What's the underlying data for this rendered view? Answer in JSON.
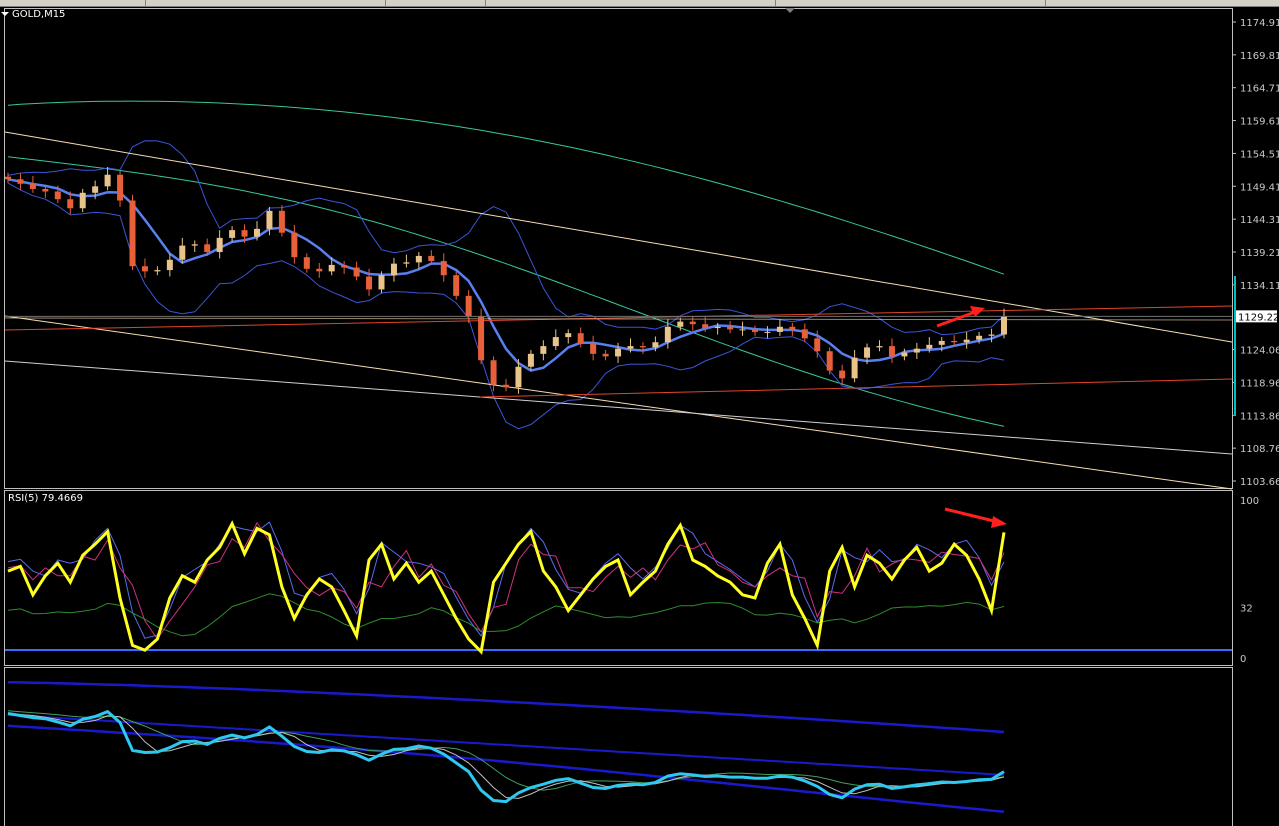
{
  "window": {
    "symbol_label": "GOLD,M15"
  },
  "colors": {
    "background": "#000000",
    "bull_candle": "#e8c48a",
    "bear_candle": "#e8603a",
    "ma_fast": "#5a7ff0",
    "bb_band": "#3a55d8",
    "envelope": "#37c7a0",
    "trend_light": "#f5deb3",
    "trend_red": "#e0452a",
    "rsi_main": "#ffff20",
    "rsi_level": "#3a6cff",
    "osc_main": "#2ec8f0",
    "osc_band": "#1a1acc",
    "arrow": "#ff2020",
    "current_price_box": "#ffffff"
  },
  "price_axis": {
    "ticks": [
      "1174.91",
      "1169.81",
      "1164.71",
      "1159.61",
      "1154.51",
      "1149.41",
      "1144.31",
      "1139.21",
      "1134.11",
      "1129.22",
      "1124.06",
      "1118.96",
      "1113.86",
      "1108.76",
      "1103.66"
    ],
    "current_price": "1129.22"
  },
  "rsi_pane": {
    "title": "RSI(5) 79.4669",
    "levels": [
      "100",
      "32",
      "0"
    ]
  },
  "chart_data": [
    {
      "type": "line",
      "title": "GOLD,M15",
      "ylim": [
        1103.66,
        1174.91
      ],
      "series": [
        {
          "values": [
            1150.5,
            1149.8,
            1149.0,
            1148.6,
            1147.4,
            1146.0,
            1148.4,
            1149.4,
            1151.2,
            1147.2,
            1137.0,
            1136.2,
            1136.4,
            1138.0,
            1140.2,
            1140.4,
            1139.2,
            1141.4,
            1142.6,
            1141.6,
            1142.8,
            1145.6,
            1142.2,
            1138.4,
            1136.6,
            1136.2,
            1137.2,
            1136.8,
            1135.4,
            1133.4,
            1135.6,
            1137.4,
            1137.6,
            1138.6,
            1137.8,
            1135.6,
            1132.4,
            1129.2,
            1122.4,
            1118.6,
            1118.2,
            1121.4,
            1123.4,
            1124.6,
            1126.0,
            1126.6,
            1125.0,
            1123.4,
            1123.0,
            1124.2,
            1124.6,
            1124.4,
            1125.2,
            1127.6,
            1128.4,
            1128.0,
            1127.4,
            1127.6,
            1127.2,
            1127.2,
            1126.8,
            1126.8,
            1127.6,
            1127.2,
            1125.8,
            1123.8,
            1120.8,
            1119.6,
            1122.8,
            1124.4,
            1124.6,
            1123.0,
            1123.6,
            1124.2,
            1124.8,
            1125.4,
            1125.2,
            1125.6,
            1126.2,
            1126.4,
            1129.22
          ]
        }
      ]
    },
    {
      "type": "line",
      "title": "RSI(5) 79.4669",
      "ylim": [
        0,
        100
      ],
      "series": [
        {
          "values": [
            55,
            58,
            40,
            52,
            60,
            48,
            65,
            72,
            80,
            38,
            8,
            5,
            12,
            38,
            52,
            48,
            62,
            70,
            85,
            66,
            82,
            78,
            45,
            25,
            40,
            50,
            45,
            30,
            14,
            62,
            72,
            50,
            60,
            48,
            55,
            40,
            25,
            12,
            4,
            48,
            60,
            72,
            80,
            55,
            45,
            30,
            40,
            50,
            58,
            62,
            40,
            48,
            55,
            72,
            84,
            62,
            58,
            52,
            48,
            40,
            38,
            60,
            72,
            40,
            25,
            8,
            55,
            70,
            45,
            65,
            60,
            50,
            62,
            70,
            55,
            60,
            72,
            65,
            50,
            30,
            79.4669
          ]
        }
      ]
    }
  ]
}
